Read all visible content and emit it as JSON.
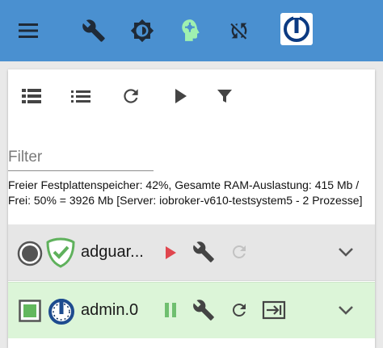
{
  "colors": {
    "appbar": "#4a90d0",
    "active_icon": "#9ff0b0",
    "play": "#e0464e",
    "pause": "#6fbf6f",
    "row_running": "#dcf5d8",
    "row_stopped": "#e6e6e6"
  },
  "appbar": {
    "icons": [
      "menu-icon",
      "wrench-icon",
      "brightness-icon",
      "head-icon",
      "sync-disabled-icon",
      "iobroker-logo"
    ]
  },
  "toolbar": {
    "icons": [
      "list-icon",
      "list-compact-icon",
      "refresh-icon",
      "play-icon",
      "filter-icon"
    ]
  },
  "filter": {
    "placeholder": "Filter",
    "value": ""
  },
  "system_info": "Freier Festplattenspeicher: 42%, Gesamte RAM-Auslastung: 415 Mb / Frei: 50% = 3926 Mb [Server: iobroker-v610-testsystem5 - 2 Prozesse]",
  "instances": [
    {
      "name": "adguar...",
      "status": "stopped",
      "icon": "adguard-shield-icon",
      "actions": [
        "play-icon",
        "wrench-icon",
        "restart-icon"
      ]
    },
    {
      "name": "admin.0",
      "status": "running",
      "icon": "iobroker-admin-icon",
      "actions": [
        "pause-icon",
        "wrench-icon",
        "restart-icon",
        "open-link-icon"
      ]
    }
  ]
}
